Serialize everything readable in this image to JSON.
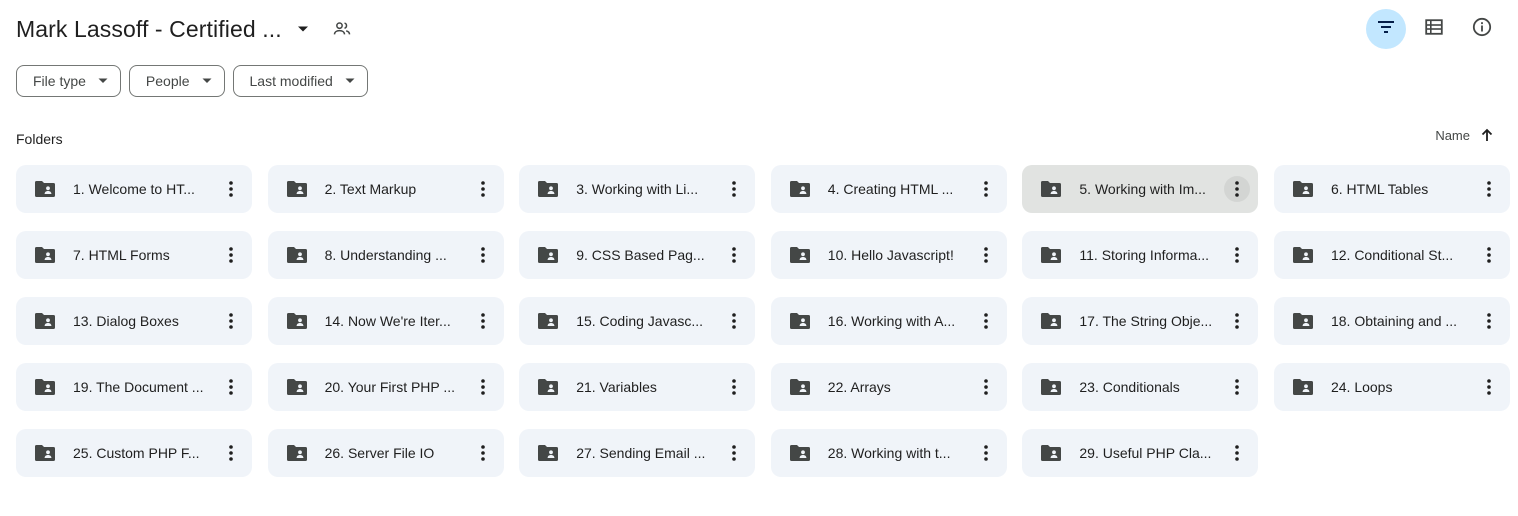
{
  "header": {
    "title": "Mark Lassoff - Certified ...",
    "title_caret_icon": "arrow-drop-down-icon",
    "shared_icon": "shared-people-icon"
  },
  "top_actions": [
    {
      "icon": "filter-icon",
      "active": true
    },
    {
      "icon": "list-view-icon",
      "active": false
    },
    {
      "icon": "info-icon",
      "active": false
    }
  ],
  "filters": {
    "file_type": "File type",
    "people": "People",
    "last_modified": "Last modified"
  },
  "section": {
    "label": "Folders"
  },
  "sort": {
    "label": "Name",
    "icon": "arrow-upward-icon"
  },
  "colors": {
    "folder_bg": "#f0f4f9",
    "folder_selected_bg": "#e1e3e1",
    "accent": "#c2e7ff",
    "icon": "#444746"
  },
  "folders": [
    {
      "name": "1. Welcome to HT..."
    },
    {
      "name": "2. Text Markup"
    },
    {
      "name": "3. Working with Li..."
    },
    {
      "name": "4. Creating HTML ..."
    },
    {
      "name": "5. Working with Im...",
      "selected": true
    },
    {
      "name": "6. HTML Tables"
    },
    {
      "name": "7. HTML Forms"
    },
    {
      "name": "8. Understanding ..."
    },
    {
      "name": "9. CSS Based Pag..."
    },
    {
      "name": "10. Hello Javascript!"
    },
    {
      "name": "11. Storing Informa..."
    },
    {
      "name": "12. Conditional St..."
    },
    {
      "name": "13. Dialog Boxes"
    },
    {
      "name": "14. Now We're Iter..."
    },
    {
      "name": "15. Coding Javasc..."
    },
    {
      "name": "16. Working with A..."
    },
    {
      "name": "17. The String Obje..."
    },
    {
      "name": "18. Obtaining and ..."
    },
    {
      "name": "19. The Document ..."
    },
    {
      "name": "20. Your First PHP ..."
    },
    {
      "name": "21. Variables"
    },
    {
      "name": "22. Arrays"
    },
    {
      "name": "23. Conditionals"
    },
    {
      "name": "24. Loops"
    },
    {
      "name": "25. Custom PHP F..."
    },
    {
      "name": "26. Server File IO"
    },
    {
      "name": "27. Sending Email ..."
    },
    {
      "name": "28. Working with t..."
    },
    {
      "name": "29. Useful PHP Cla..."
    }
  ]
}
